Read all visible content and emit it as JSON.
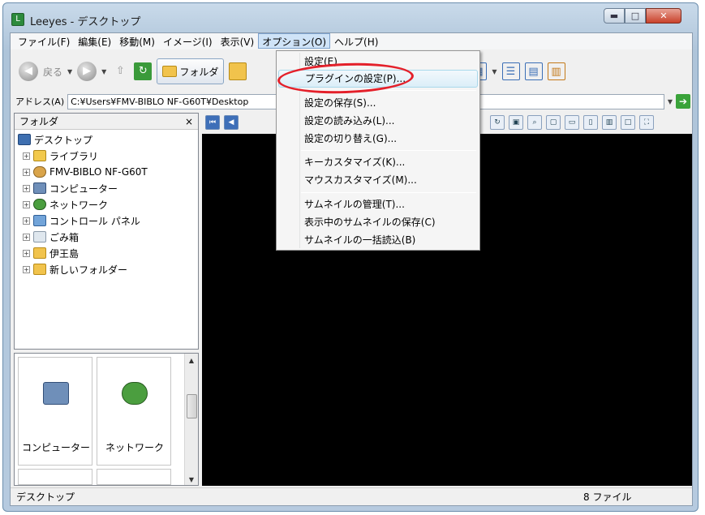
{
  "window": {
    "title": "Leeyes - デスクトップ",
    "minimize": "▬",
    "maximize": "□",
    "close": "✕"
  },
  "menu": [
    "ファイル(F)",
    "編集(E)",
    "移動(M)",
    "イメージ(I)",
    "表示(V)",
    "オプション(O)",
    "ヘルプ(H)"
  ],
  "toolbar": {
    "back": "戻る",
    "folder": "フォルダ"
  },
  "address": {
    "label": "アドレス(A)",
    "value": "C:¥Users¥FMV-BIBLO NF-G60T¥Desktop"
  },
  "folder_panel": {
    "title": "フォルダ",
    "close": "×",
    "tree": [
      "デスクトップ",
      "ライブラリ",
      "FMV-BIBLO NF-G60T",
      "コンピューター",
      "ネットワーク",
      "コントロール パネル",
      "ごみ箱",
      "伊王島",
      "新しいフォルダー"
    ]
  },
  "thumbnails": [
    "コンピューター",
    "ネットワーク"
  ],
  "status": {
    "left": "デスクトップ",
    "right": "8 ファイル"
  },
  "options_menu": {
    "items": [
      "設定(E)",
      "プラグインの設定(P)...",
      "設定の保存(S)...",
      "設定の読み込み(L)...",
      "設定の切り替え(G)...",
      "キーカスタマイズ(K)...",
      "マウスカスタマイズ(M)...",
      "サムネイルの管理(T)...",
      "表示中のサムネイルの保存(C)",
      "サムネイルの一括読込(B)"
    ],
    "highlighted": "プラグインの設定(P)..."
  },
  "colors": {
    "annotation": "#e4202a",
    "viewer_bg": "#000000",
    "menu_highlight": "#dbeef8"
  }
}
